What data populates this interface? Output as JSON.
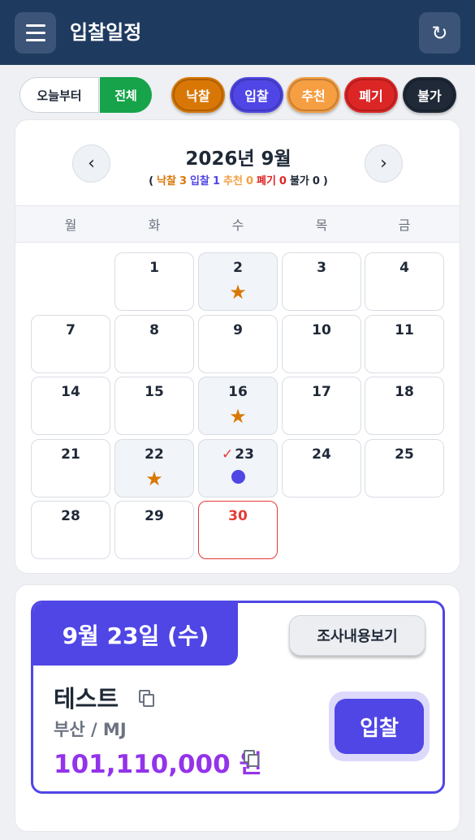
{
  "header": {
    "title": "입찰일정",
    "menu_icon": "menu-icon",
    "refresh_icon": "↻"
  },
  "filters": {
    "today_label": "오늘부터",
    "all_label": "전체",
    "categories": [
      {
        "label": "낙찰",
        "color": "#d97706"
      },
      {
        "label": "입찰",
        "color": "#4f46e5"
      },
      {
        "label": "추천",
        "color": "#f59e42"
      },
      {
        "label": "폐기",
        "color": "#dc2626"
      },
      {
        "label": "불가",
        "color": "#1f2937"
      }
    ]
  },
  "calendar": {
    "title": "2026년 9월",
    "prev": "‹",
    "next": "›",
    "summary": {
      "open": "(",
      "close": ")",
      "items": [
        {
          "label": "낙찰",
          "count": "3",
          "color": "#d97706"
        },
        {
          "label": "입찰",
          "count": "1",
          "color": "#4f46e5"
        },
        {
          "label": "추천",
          "count": "0",
          "color": "#f59e42"
        },
        {
          "label": "폐기",
          "count": "0",
          "color": "#dc2626"
        },
        {
          "label": "불가",
          "count": "0",
          "color": "#1f2937"
        }
      ]
    },
    "weekdays": [
      "월",
      "화",
      "수",
      "목",
      "금"
    ],
    "days": [
      {
        "num": "1",
        "row": 0,
        "col": 1
      },
      {
        "num": "2",
        "row": 0,
        "col": 2,
        "mark": "star"
      },
      {
        "num": "3",
        "row": 0,
        "col": 3
      },
      {
        "num": "4",
        "row": 0,
        "col": 4
      },
      {
        "num": "7",
        "row": 1,
        "col": 0
      },
      {
        "num": "8",
        "row": 1,
        "col": 1
      },
      {
        "num": "9",
        "row": 1,
        "col": 2
      },
      {
        "num": "10",
        "row": 1,
        "col": 3
      },
      {
        "num": "11",
        "row": 1,
        "col": 4
      },
      {
        "num": "14",
        "row": 2,
        "col": 0
      },
      {
        "num": "15",
        "row": 2,
        "col": 1
      },
      {
        "num": "16",
        "row": 2,
        "col": 2,
        "mark": "star"
      },
      {
        "num": "17",
        "row": 2,
        "col": 3
      },
      {
        "num": "18",
        "row": 2,
        "col": 4
      },
      {
        "num": "21",
        "row": 3,
        "col": 0
      },
      {
        "num": "22",
        "row": 3,
        "col": 1,
        "mark": "star"
      },
      {
        "num": "23",
        "row": 3,
        "col": 2,
        "mark": "dot",
        "check": "✓"
      },
      {
        "num": "24",
        "row": 3,
        "col": 3
      },
      {
        "num": "25",
        "row": 3,
        "col": 4
      },
      {
        "num": "28",
        "row": 4,
        "col": 0
      },
      {
        "num": "29",
        "row": 4,
        "col": 1
      },
      {
        "num": "30",
        "row": 4,
        "col": 2,
        "today": true
      }
    ],
    "star_glyph": "★"
  },
  "detail": {
    "date": "9월 23일 (수)",
    "survey_button": "조사내용보기",
    "name": "테스트",
    "location": "부산 / MJ",
    "price": "101,110,000 원",
    "status_button": "입찰"
  }
}
